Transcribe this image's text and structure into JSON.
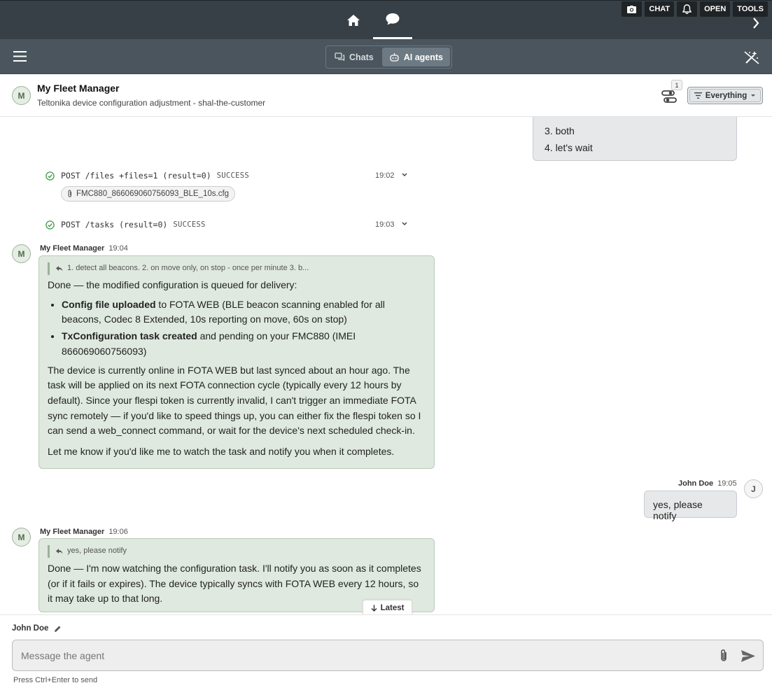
{
  "topbar": {
    "nav": [
      {
        "icon": "home-icon"
      },
      {
        "icon": "chat-bubble-icon",
        "active": true
      }
    ],
    "actions": [
      {
        "icon": "camera-icon"
      },
      {
        "label": "CHAT"
      },
      {
        "icon": "bell-icon"
      },
      {
        "label": "OPEN"
      },
      {
        "label": "TOOLS"
      }
    ]
  },
  "subbar": {
    "tabs": [
      {
        "label": "Chats",
        "icon": "chats-icon"
      },
      {
        "label": "AI agents",
        "icon": "robot-icon",
        "active": true
      }
    ]
  },
  "chat_header": {
    "avatar": "M",
    "title": "My Fleet Manager",
    "subtitle": "Teltonika device configuration adjustment - shal-the-customer",
    "tasks_badge": "1",
    "filter_label": "Everything"
  },
  "messages": {
    "prev_user_items": [
      "3. both",
      "4. let's wait"
    ],
    "log1": {
      "text": "POST /files +files=1 (result=0)",
      "status": "SUCCESS",
      "time": "19:02",
      "file": "FMC880_866069060756093_BLE_10s.cfg"
    },
    "log2": {
      "text": "POST /tasks (result=0)",
      "status": "SUCCESS",
      "time": "19:03"
    },
    "agent1": {
      "author": "My Fleet Manager",
      "time": "19:04",
      "quote": "1. detect all beacons. 2. on move only, on stop - once per minute 3. b...",
      "intro": "Done — the modified configuration is queued for delivery:",
      "b1_strong": "Config file uploaded",
      "b1_rest": " to FOTA WEB (BLE beacon scanning enabled for all beacons, Codec 8 Extended, 10s reporting on move, 60s on stop)",
      "b2_strong": "TxConfiguration task created",
      "b2_rest": " and pending on your FMC880 (IMEI 866069060756093)",
      "para": "The device is currently online in FOTA WEB but last synced about an hour ago. The task will be applied on its next FOTA connection cycle (typically every 12 hours by default). Since your flespi token is currently invalid, I can't trigger an immediate FOTA sync remotely — if you'd like to speed things up, you can either fix the flespi token so I can send a web_connect command, or wait for the device's next scheduled check-in.",
      "closing": "Let me know if you'd like me to watch the task and notify you when it completes."
    },
    "user1": {
      "author": "John Doe",
      "time": "19:05",
      "avatar": "J",
      "text": "yes, please notify"
    },
    "agent2": {
      "author": "My Fleet Manager",
      "time": "19:06",
      "quote": "yes, please notify",
      "text": "Done — I'm now watching the configuration task. I'll notify you as soon as it completes (or if it fails or expires). The device typically syncs with FOTA WEB every 12 hours, so it may take up to that long."
    },
    "latest_label": "Latest"
  },
  "composer": {
    "user": "John Doe",
    "placeholder": "Message the agent",
    "hint": "Press Ctrl+Enter to send"
  }
}
